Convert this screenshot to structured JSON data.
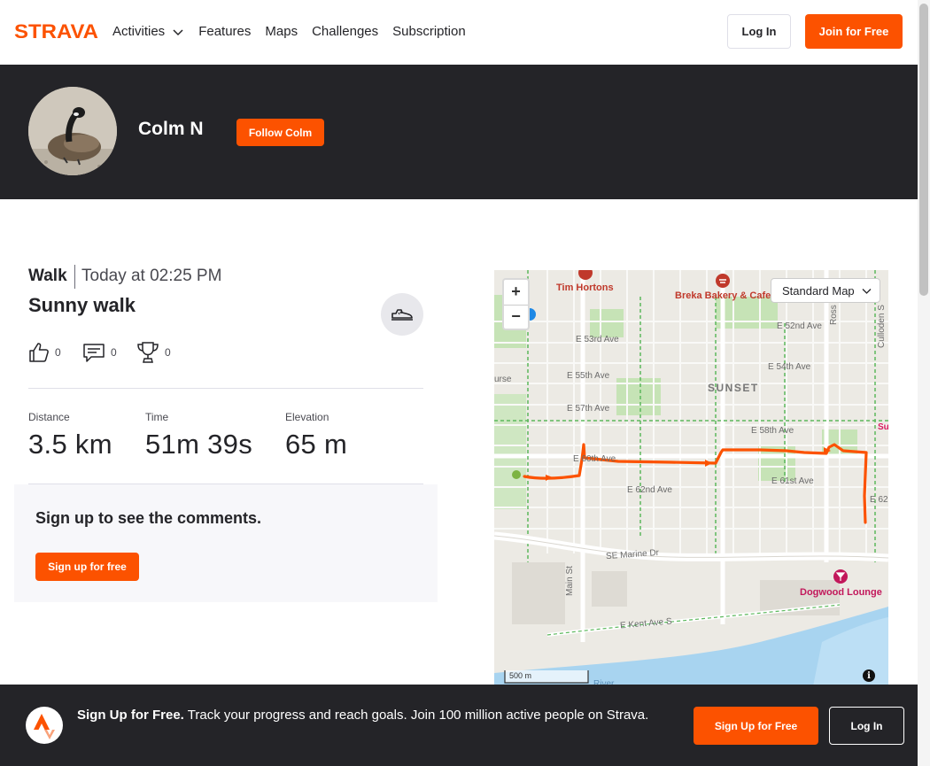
{
  "nav": {
    "logo_text": "STRAVA",
    "links": [
      {
        "label": "Activities"
      },
      {
        "label": "Features"
      },
      {
        "label": "Maps"
      },
      {
        "label": "Challenges"
      },
      {
        "label": "Subscription"
      }
    ],
    "login_label": "Log In",
    "join_label": "Join for Free"
  },
  "athlete": {
    "name": "Colm N",
    "follow_label": "Follow Colm"
  },
  "activity": {
    "type": "Walk",
    "datetime": "Today at 02:25 PM",
    "title": "Sunny walk",
    "kudos_count": "0",
    "comments_count": "0",
    "achievements_count": "0",
    "stats": [
      {
        "label": "Distance",
        "value": "3.5 km"
      },
      {
        "label": "Time",
        "value": "51m 39s"
      },
      {
        "label": "Elevation",
        "value": "65 m"
      }
    ]
  },
  "comments": {
    "title": "Sign up to see the comments.",
    "button_label": "Sign up for free"
  },
  "map": {
    "style_label": "Standard Map",
    "zoom_in": "+",
    "zoom_out": "−",
    "scale": "500 m",
    "info": "i",
    "street_labels": [
      "E 52nd Ave",
      "E 53rd Ave",
      "E 54th Ave",
      "E 55th Ave",
      "E 57th Ave",
      "E 58th Ave",
      "E 60th Ave",
      "E 61st Ave",
      "E 62nd Ave",
      "E 62nd Av",
      "SE Marine Dr",
      "Main St",
      "E Kent Ave S",
      "Ross",
      "Culloden S",
      "urse",
      "Su",
      "River"
    ],
    "neighborhood": "SUNSET",
    "pois": [
      "Tim Hortons",
      "Breka Bakery & Cafe",
      "Dogwood Lounge"
    ],
    "route_color": "#fc5200"
  },
  "footer": {
    "headline": "Sign Up for Free.",
    "body": "Track your progress and reach goals. Join 100 million active people on Strava.",
    "signup_label": "Sign Up for Free",
    "login_label": "Log In"
  },
  "colors": {
    "brand": "#fc5200",
    "dark": "#242428"
  }
}
